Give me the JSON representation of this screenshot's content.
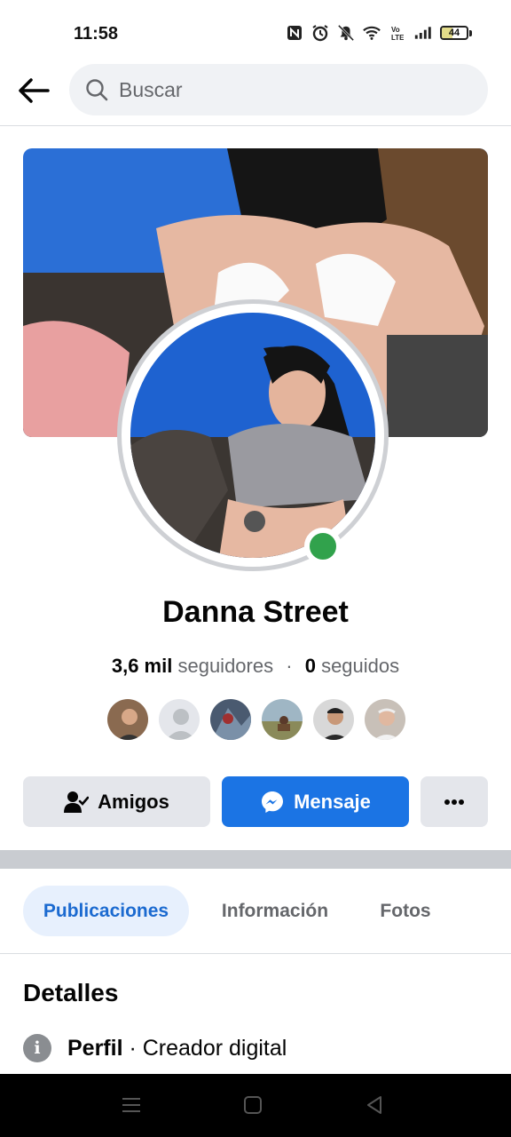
{
  "status_bar": {
    "time": "11:58",
    "icons": [
      "nfc-icon",
      "alarm-icon",
      "mute-icon",
      "wifi-icon",
      "volte-icon",
      "signal-icon"
    ],
    "battery_level": "44",
    "battery_fraction": 0.44
  },
  "header": {
    "search_placeholder": "Buscar"
  },
  "profile": {
    "name": "Danna Street",
    "followers_count": "3,6 mil",
    "followers_label": "seguidores",
    "separator": "·",
    "following_count": "0",
    "following_label": "seguidos",
    "online": true
  },
  "mutual_friends": [
    "friend-avatar",
    "friend-avatar-placeholder",
    "friend-avatar",
    "friend-avatar",
    "friend-avatar",
    "friend-avatar"
  ],
  "actions": {
    "friends_label": "Amigos",
    "message_label": "Mensaje",
    "more_label": "···"
  },
  "tabs": [
    {
      "label": "Publicaciones",
      "active": true
    },
    {
      "label": "Información",
      "active": false
    },
    {
      "label": "Fotos",
      "active": false
    }
  ],
  "details": {
    "title": "Detalles",
    "profile_label": "Perfil",
    "profile_value": " · Creador digital"
  },
  "colors": {
    "accent": "#1b74e4",
    "online": "#31a24c",
    "tab_active_bg": "#e7f0fd"
  }
}
